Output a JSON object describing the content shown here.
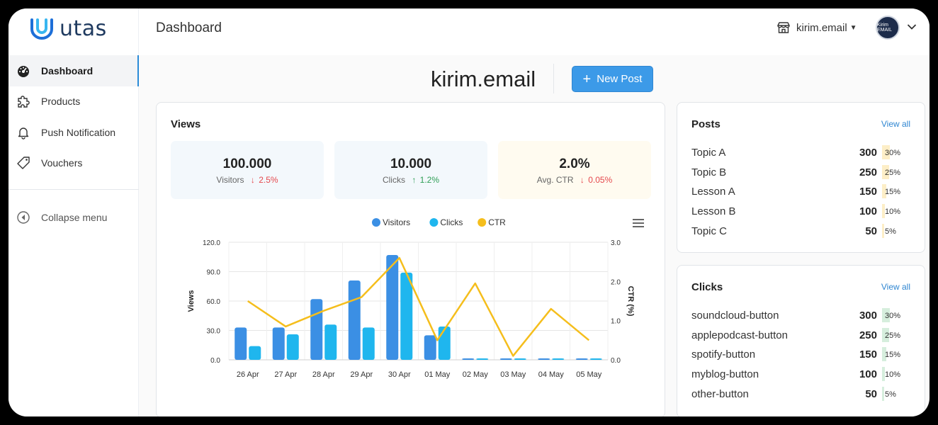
{
  "app": {
    "name": "utas"
  },
  "sidebar": {
    "items": [
      {
        "label": "Dashboard",
        "icon": "dashboard-gauge-icon",
        "active": true
      },
      {
        "label": "Products",
        "icon": "puzzle-icon"
      },
      {
        "label": "Push Notification",
        "icon": "bell-icon"
      },
      {
        "label": "Vouchers",
        "icon": "ticket-icon"
      }
    ],
    "collapse_label": "Collapse menu"
  },
  "topbar": {
    "title": "Dashboard",
    "store_name": "kirim.email",
    "avatar_text": "Kirim EMAIL"
  },
  "header": {
    "title": "kirim.email",
    "new_post_label": "New Post"
  },
  "views": {
    "title": "Views",
    "stats": [
      {
        "value": "100.000",
        "label": "Visitors",
        "delta": "2.5%",
        "direction": "down",
        "bg": "#f3f8fc"
      },
      {
        "value": "10.000",
        "label": "Clicks",
        "delta": "1.2%",
        "direction": "up",
        "bg": "#f3f8fc"
      },
      {
        "value": "2.0%",
        "label": "Avg. CTR",
        "delta": "0.05%",
        "direction": "down",
        "bg": "#fffbf0"
      }
    ]
  },
  "chart_data": {
    "type": "bar",
    "categories": [
      "26 Apr",
      "27 Apr",
      "28 Apr",
      "29 Apr",
      "30 Apr",
      "01 May",
      "02 May",
      "03 May",
      "04 May",
      "05 May"
    ],
    "series": [
      {
        "name": "Visitors",
        "type": "bar",
        "axis": "left",
        "color": "#3b8fe4",
        "values": [
          33,
          33,
          62,
          81,
          107,
          25,
          1,
          1,
          1,
          1
        ]
      },
      {
        "name": "Clicks",
        "type": "bar",
        "axis": "left",
        "color": "#1fb6ee",
        "values": [
          14,
          26,
          36,
          33,
          89,
          34,
          1,
          1,
          1,
          1
        ]
      },
      {
        "name": "CTR",
        "type": "line",
        "axis": "right",
        "color": "#f5be1c",
        "values": [
          1.5,
          0.85,
          1.25,
          1.6,
          2.6,
          0.5,
          1.95,
          0.1,
          1.3,
          0.5
        ]
      }
    ],
    "y_left": {
      "label": "Views",
      "ticks": [
        "0.0",
        "30.0",
        "60.0",
        "90.0",
        "120.0"
      ],
      "range": [
        0,
        120
      ]
    },
    "y_right": {
      "label": "CTR (%)",
      "ticks": [
        "0.0",
        "1.0",
        "2.0",
        "3.0"
      ],
      "range": [
        0,
        3
      ]
    },
    "legend": "top",
    "grid": true
  },
  "posts": {
    "title": "Posts",
    "view_all": "View all",
    "fill_color": "#fdeec7",
    "rows": [
      {
        "label": "Topic A",
        "count": "300",
        "pct": "30%",
        "fraction": 0.3
      },
      {
        "label": "Topic B",
        "count": "250",
        "pct": "25%",
        "fraction": 0.25
      },
      {
        "label": "Lesson A",
        "count": "150",
        "pct": "15%",
        "fraction": 0.15
      },
      {
        "label": "Lesson B",
        "count": "100",
        "pct": "10%",
        "fraction": 0.1
      },
      {
        "label": "Topic C",
        "count": "50",
        "pct": "5%",
        "fraction": 0.05
      }
    ]
  },
  "clicks": {
    "title": "Clicks",
    "view_all": "View all",
    "fill_color": "#d6eedd",
    "rows": [
      {
        "label": "soundcloud-button",
        "count": "300",
        "pct": "30%",
        "fraction": 0.3
      },
      {
        "label": "applepodcast-button",
        "count": "250",
        "pct": "25%",
        "fraction": 0.25
      },
      {
        "label": "spotify-button",
        "count": "150",
        "pct": "15%",
        "fraction": 0.15
      },
      {
        "label": "myblog-button",
        "count": "100",
        "pct": "10%",
        "fraction": 0.1
      },
      {
        "label": "other-button",
        "count": "50",
        "pct": "5%",
        "fraction": 0.05
      }
    ]
  }
}
